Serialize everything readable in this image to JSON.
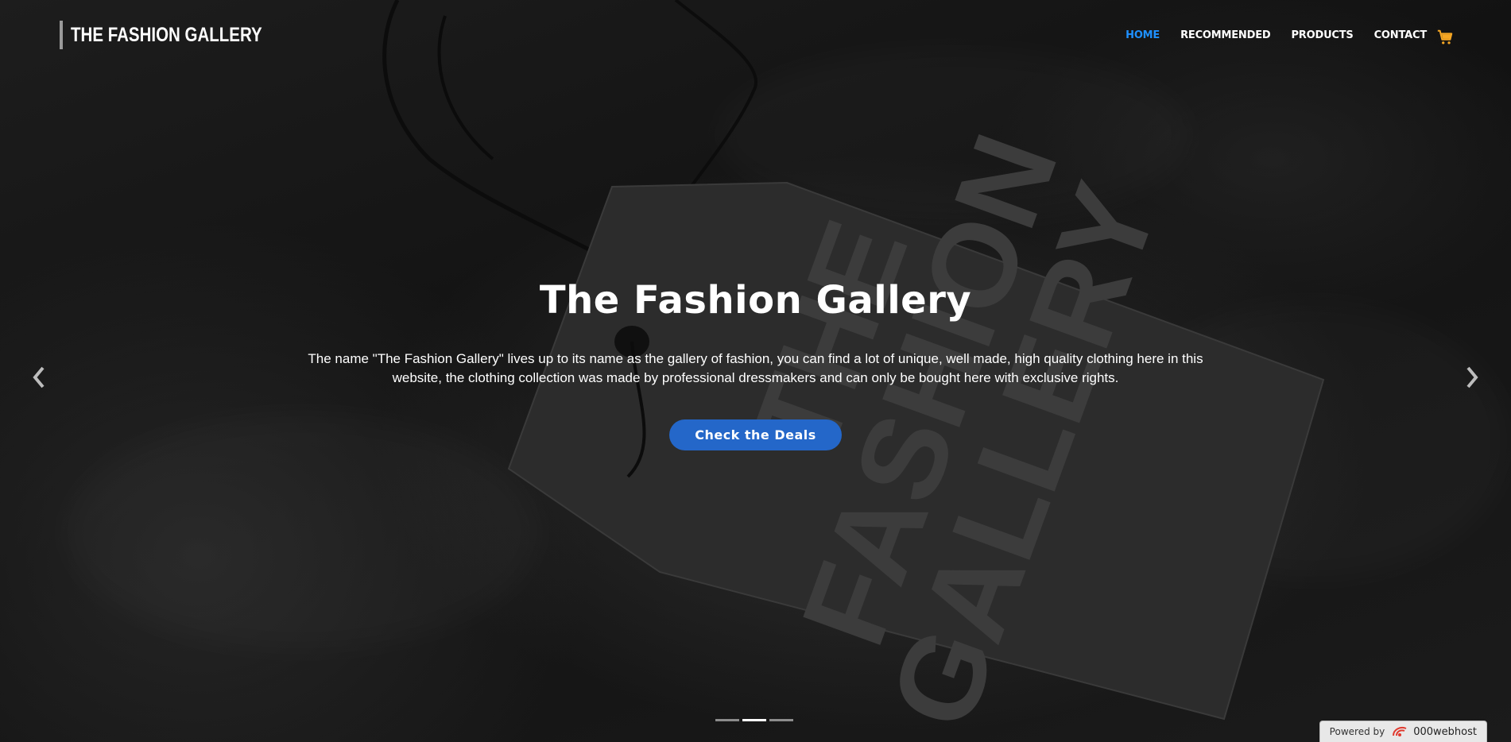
{
  "brand": {
    "logo_text": "THE FASHION GALLERY"
  },
  "nav": {
    "items": [
      {
        "label": "HOME",
        "active": true
      },
      {
        "label": "RECOMMENDED",
        "active": false
      },
      {
        "label": "PRODUCTS",
        "active": false
      },
      {
        "label": "CONTACT",
        "active": false
      }
    ],
    "cart_icon": "shopping-cart-icon",
    "cart_color": "#f5a623",
    "active_color": "#1e90ff"
  },
  "hero": {
    "title": "The Fashion Gallery",
    "description": "The name \"The Fashion Gallery\" lives up to its name as the gallery of fashion, you can find a lot of unique, well made, high quality clothing here in this website, the clothing collection was made by professional dressmakers and can only be bought here with exclusive rights.",
    "cta_label": "Check the Deals",
    "cta_color": "#2467c9",
    "tag_text_line1": "THE",
    "tag_text_line2": "FASHION",
    "tag_text_line3": "GALLERY"
  },
  "carousel": {
    "prev_icon": "chevron-left-icon",
    "next_icon": "chevron-right-icon",
    "slide_count": 3,
    "active_slide": 2
  },
  "footer_badge": {
    "prefix": "Powered by",
    "brand": "000webhost"
  }
}
